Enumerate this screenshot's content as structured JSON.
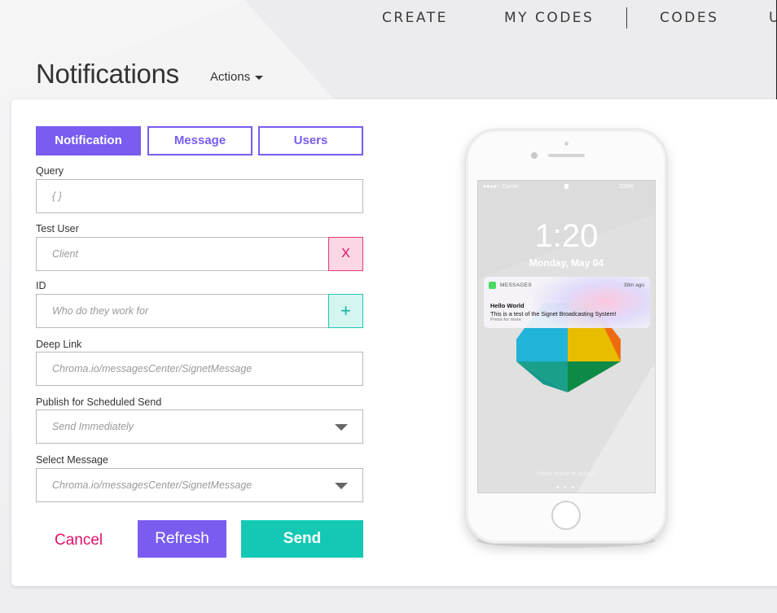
{
  "nav": {
    "items": [
      "CREATE",
      "MY CODES",
      "CODES",
      "U"
    ]
  },
  "header": {
    "title": "Notifications",
    "actions_label": "Actions"
  },
  "tabs": [
    {
      "label": "Notification",
      "active": true
    },
    {
      "label": "Message",
      "active": false
    },
    {
      "label": "Users",
      "active": false
    }
  ],
  "form": {
    "query": {
      "label": "Query",
      "placeholder": "{ }"
    },
    "test_user": {
      "label": "Test User",
      "placeholder": "Client",
      "remove_label": "X"
    },
    "id": {
      "label": "ID",
      "placeholder": "Who do they work for",
      "add_label": "+"
    },
    "deep_link": {
      "label": "Deep Link",
      "placeholder": "Chroma.io/messagesCenter/SignetMessage"
    },
    "publish": {
      "label": "Publish for Scheduled Send",
      "value": "Send Immediately"
    },
    "select_message": {
      "label": "Select Message",
      "value": "Chroma.io/messagesCenter/SignetMessage"
    }
  },
  "buttons": {
    "cancel": "Cancel",
    "refresh": "Refresh",
    "send": "Send"
  },
  "preview": {
    "status_carrier": "●●●●○ Carrier",
    "status_battery": "100%",
    "time": "1:20",
    "date": "Monday, May 04",
    "notification": {
      "app": "MESSAGES",
      "ago": "38m ago",
      "title": "Hello World",
      "body": "This is a test of the Signet Broadcasting System!",
      "more": "Press for more"
    },
    "unlock_hint": "Press home to unlock",
    "page_dots": "● ● ●"
  },
  "colors": {
    "accent_purple": "#7a5cf0",
    "accent_teal": "#14c8b4",
    "accent_pink": "#e0106a"
  }
}
